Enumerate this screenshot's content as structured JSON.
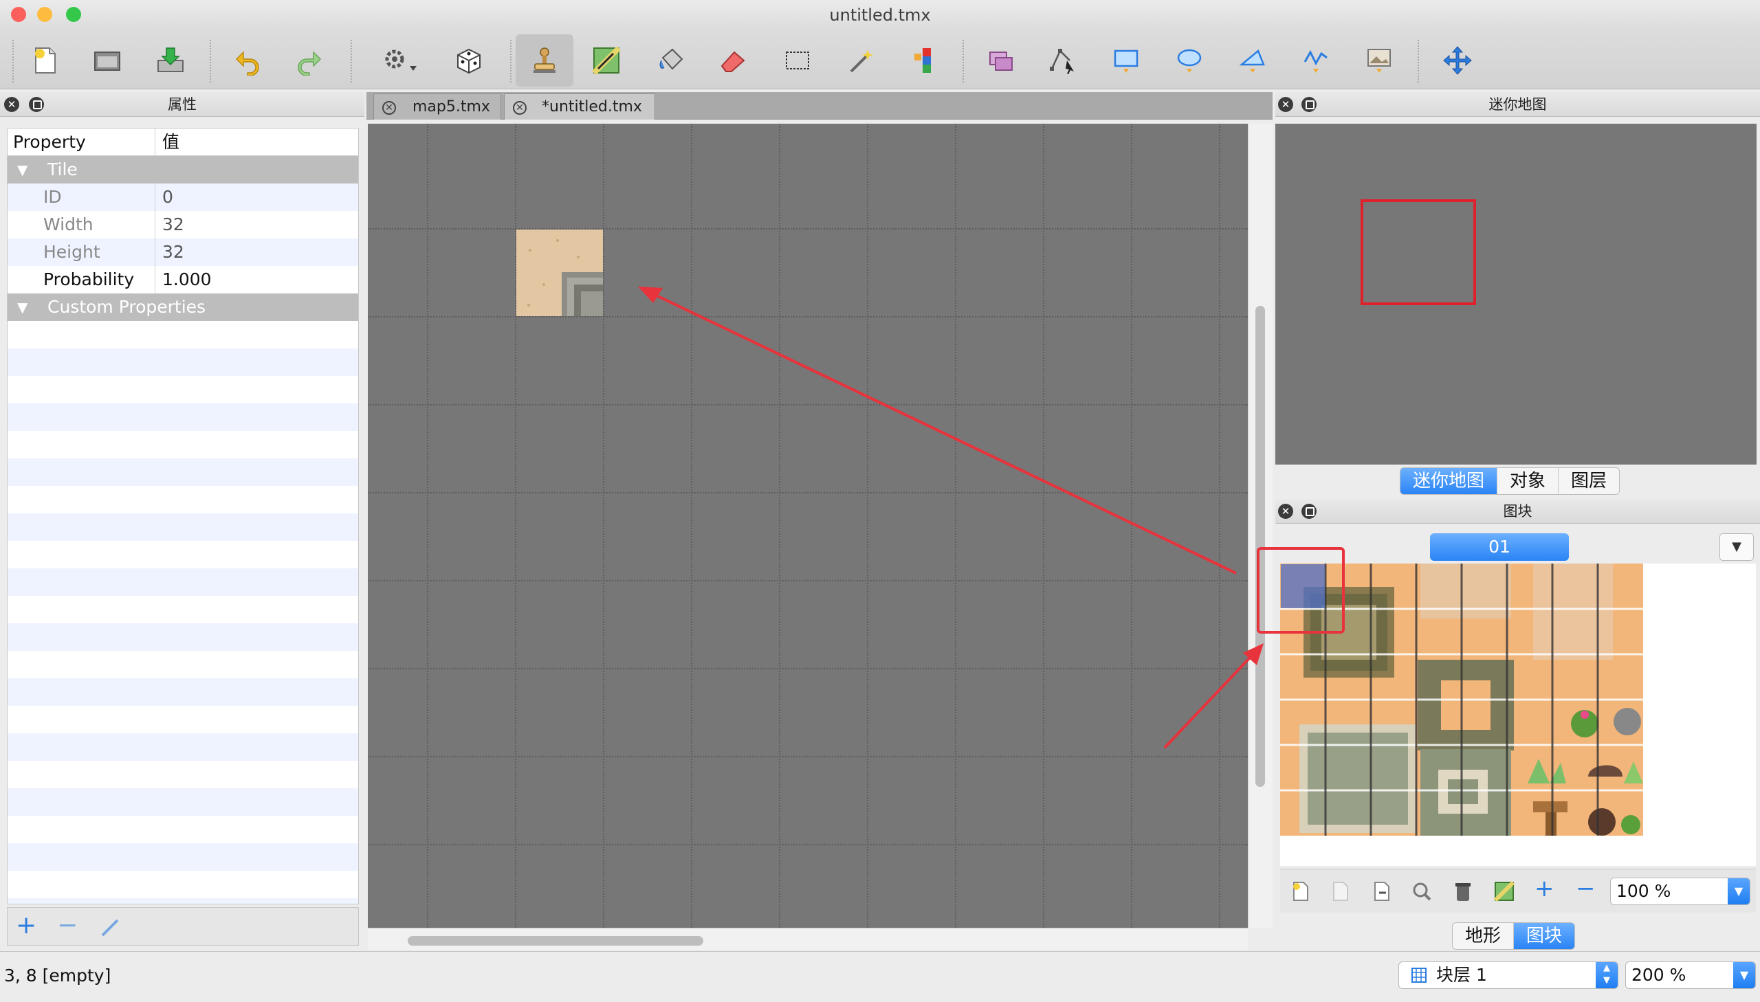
{
  "window": {
    "title": "untitled.tmx",
    "traffic_colors": [
      "#fc605c",
      "#fdbc40",
      "#34c84a"
    ]
  },
  "toolbar": {
    "groups": [
      [
        "new-file-icon",
        "open-file-icon",
        "save-file-icon"
      ],
      [
        "undo-icon",
        "redo-icon"
      ],
      [
        "command-gear-icon",
        "random-dice-icon"
      ],
      [
        "stamp-brush-icon",
        "terrain-brush-icon",
        "bucket-fill-icon",
        "eraser-icon",
        "rect-select-icon",
        "magic-wand-icon",
        "select-same-tile-icon"
      ],
      [
        "select-objects-icon",
        "edit-polygons-icon",
        "insert-rectangle-icon",
        "insert-ellipse-icon",
        "insert-polygon-icon",
        "insert-polyline-icon",
        "insert-tile-icon"
      ],
      [
        "move-cross-icon"
      ]
    ]
  },
  "properties_panel": {
    "title": "属性",
    "col_property": "Property",
    "col_value": "值",
    "group_tile": "Tile",
    "rows": [
      {
        "name": "ID",
        "value": "0"
      },
      {
        "name": "Width",
        "value": "32"
      },
      {
        "name": "Height",
        "value": "32"
      },
      {
        "name": "Probability",
        "value": "1.000"
      }
    ],
    "group_custom": "Custom Properties",
    "add_symbol": "+",
    "remove_symbol": "−"
  },
  "tabs": [
    {
      "label": "map5.tmx",
      "active": false
    },
    {
      "label": "*untitled.tmx",
      "active": true
    }
  ],
  "minimap_panel": {
    "title": "迷你地图"
  },
  "mid_tabs": {
    "minimap": "迷你地图",
    "objects": "对象",
    "layers": "图层"
  },
  "tilesets_panel": {
    "title": "图块",
    "tileset_tab": "01",
    "zoom": "100 %"
  },
  "bottom_tabs": {
    "terrain": "地形",
    "tiles": "图块"
  },
  "status": {
    "position": "3, 8 [empty]",
    "layer": "块层 1",
    "zoom": "200 %"
  },
  "annotation_color": "#e8323c",
  "accent_color": "#2a84f5"
}
